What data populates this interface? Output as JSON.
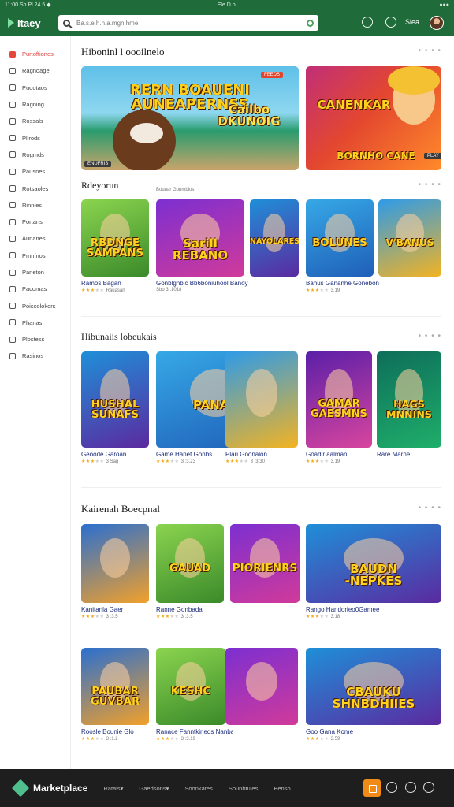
{
  "status_bar": {
    "left": "11:00 Sh.Pl 24.5 ◆",
    "center": "Ele D.pl",
    "right": "●●●"
  },
  "header": {
    "brand": "Itaey",
    "search_placeholder": "Ba.s.e.h.n.a.mgn.hme",
    "user_label": "Siea"
  },
  "sidebar": {
    "items": [
      {
        "label": "Purtoffiones",
        "icon": "home-icon",
        "active": true
      },
      {
        "label": "Ragnoage",
        "icon": "list-icon"
      },
      {
        "label": "Puootaos",
        "icon": "document-icon"
      },
      {
        "label": "Ragning",
        "icon": "triangle-icon"
      },
      {
        "label": "Rossals",
        "icon": "box-icon"
      },
      {
        "label": "Plirods",
        "icon": "grid-icon"
      },
      {
        "label": "Rogmds",
        "icon": "smile-icon"
      },
      {
        "label": "Pausnes",
        "icon": "chat-icon"
      },
      {
        "label": "Rotsaoles",
        "icon": "tool-icon"
      },
      {
        "label": "Rinnies",
        "icon": "page-icon"
      },
      {
        "label": "Portans",
        "icon": "user-icon"
      },
      {
        "label": "Aunanes",
        "icon": "s-icon"
      },
      {
        "label": "Pmnfnos",
        "icon": "card-icon"
      },
      {
        "label": "Paneton",
        "icon": "copy-icon"
      },
      {
        "label": "Pacomas",
        "icon": "table-icon"
      },
      {
        "label": "Poiscolokors",
        "icon": "cube-icon"
      },
      {
        "label": "Phanas",
        "icon": "warning-icon"
      },
      {
        "label": "Plostess",
        "icon": "list-icon"
      },
      {
        "label": "Rasinos",
        "icon": "list-icon"
      }
    ]
  },
  "main": {
    "featured": {
      "title": "Hiboninl l oooilnelo",
      "banners": [
        {
          "art": "RERN BOAUENI\nAUNEAPERNSS",
          "art2": "Cailbo\nDKUNOIG",
          "badge": "ENUFRIS",
          "tag": "FEEDS"
        },
        {
          "art": "CANENKAR",
          "art2": "BORNHO CANE",
          "tag": "PLAY"
        }
      ]
    },
    "popular": {
      "title": "Rdeyorun",
      "subtitle": "Bouuar Gonmbios",
      "cards": [
        {
          "art": "RBDNGE\nSAMPANS",
          "title": "Ramos Bagan",
          "meta": "Rauasan",
          "rating": 3
        },
        {
          "art": "Sarill\nREBANO",
          "title": "Gonblgnbic Bb6boniuhool Banoy",
          "meta": "Sbo 3 :1018",
          "rating": 0
        },
        {
          "art": "NAYOLARES",
          "title": "",
          "meta": "",
          "rating": 0
        },
        {
          "art": "BOLUNES",
          "title": "Banus Gananhe Gonebon",
          "meta": "3.19",
          "rating": 3
        },
        {
          "art": "V'BANUS",
          "title": "",
          "meta": "",
          "rating": 0
        }
      ]
    },
    "new_releases": {
      "title": "Hibunaiis lobeukais",
      "cards": [
        {
          "art": "HUSHAL\nSUNAFS",
          "title": "Geoode Garoan",
          "meta": "3 Sag",
          "rating": 3
        },
        {
          "art": "PANAN",
          "title": "Game Hanet Gonbs",
          "meta": "3 :3.23",
          "rating": 3
        },
        {
          "art": "",
          "title": "Plari Goonalon",
          "meta": "3 :3.30",
          "rating": 3
        },
        {
          "art": "GAMAR\nGAESMNS",
          "title": "Goadir aalman",
          "meta": "3.19",
          "rating": 3
        },
        {
          "art": "HAGS\nMNNINS",
          "title": "Rare Marne",
          "meta": "",
          "rating": 0
        }
      ]
    },
    "top_rated": {
      "title": "Kairenah Boecpnal",
      "cards_row1": [
        {
          "art": "",
          "title": "Kanitanla Gaer",
          "meta": "3 :3.5",
          "rating": 3
        },
        {
          "art": "GAUAD",
          "title": "Ranne Gonbada",
          "meta": "3 :3.5",
          "rating": 3
        },
        {
          "art": "PIORIENRS",
          "title": "",
          "meta": "",
          "rating": 0
        },
        {
          "art": "BAUDN\n-NEPKES",
          "title": "Rango Handorieo0Gamee",
          "meta": "3.18",
          "rating": 3
        }
      ],
      "cards_row2": [
        {
          "art": "PAUBAR\nGUVBAR",
          "title": "Roosle Bounie Glo",
          "meta": "3 :1.2",
          "rating": 3
        },
        {
          "art": "KESHC",
          "title": "Ranace Fanntkirieds Nanba",
          "meta": "3 :3.19",
          "rating": 3
        },
        {
          "art": "",
          "title": "",
          "meta": "",
          "rating": 0
        },
        {
          "art": "CBAUKU\nSHNBDHIIES",
          "title": "Goo Gana Kome",
          "meta": "3.59",
          "rating": 3
        }
      ]
    }
  },
  "bottom_bar": {
    "title": "Marketplace",
    "links": [
      "Ratais▾",
      "Gaedsons▾",
      "Soonkates",
      "Sounbtules",
      "Benso"
    ]
  },
  "colors": {
    "header": "#1f6b3a",
    "accent": "#e4483a",
    "bottom": "#1e1e1e",
    "cta": "#f08a18"
  }
}
